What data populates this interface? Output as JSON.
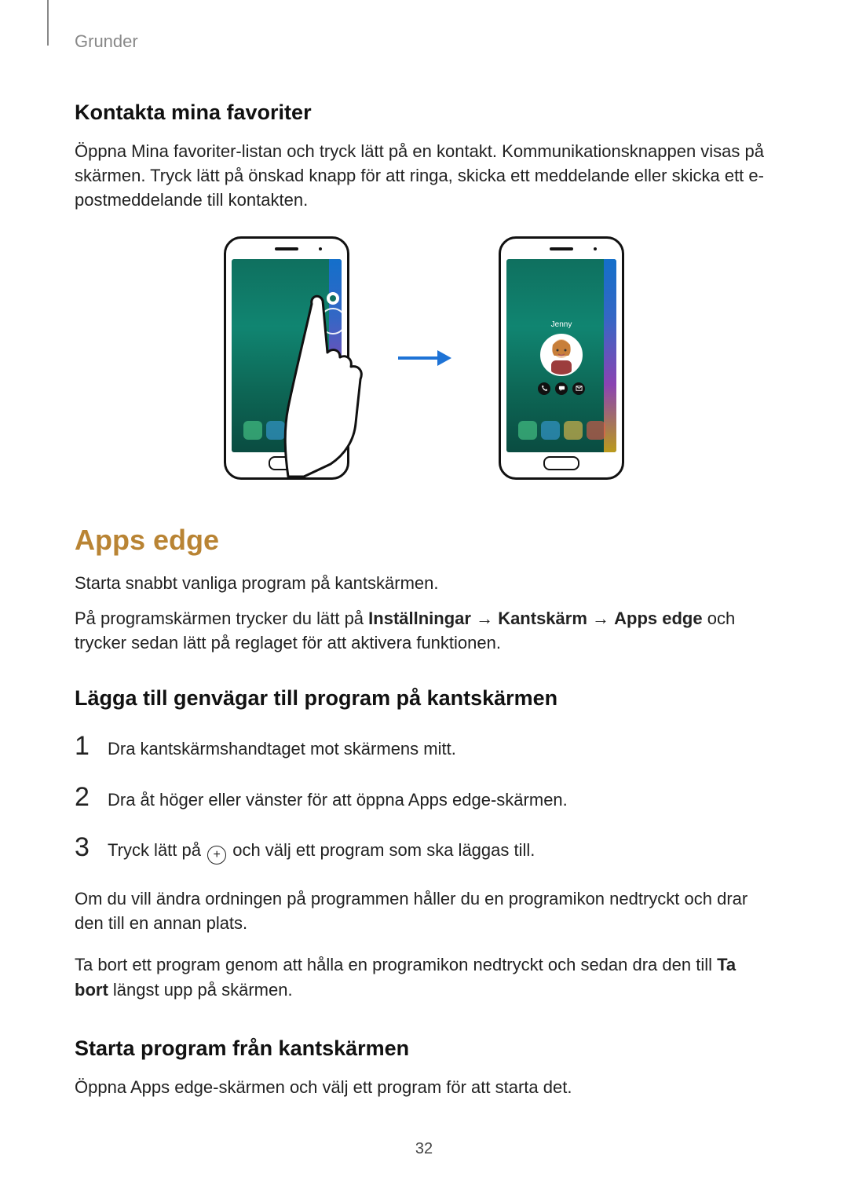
{
  "header": {
    "category": "Grunder"
  },
  "section1": {
    "heading": "Kontakta mina favoriter",
    "body": "Öppna Mina favoriter-listan och tryck lätt på en kontakt. Kommunikationsknappen visas på skärmen. Tryck lätt på önskad knapp för att ringa, skicka ett meddelande eller skicka ett e-postmeddelande till kontakten."
  },
  "illustration": {
    "contact_name": "Jenny"
  },
  "section2": {
    "title": "Apps edge",
    "intro": "Starta snabbt vanliga program på kantskärmen.",
    "path_pre": "På programskärmen trycker du lätt på ",
    "path_a": "Inställningar",
    "path_b": "Kantskärm",
    "path_c": "Apps edge",
    "path_post": " och trycker sedan lätt på reglaget för att aktivera funktionen.",
    "arrow": " → "
  },
  "section3": {
    "heading": "Lägga till genvägar till program på kantskärmen",
    "steps": [
      "Dra kantskärmshandtaget mot skärmens mitt.",
      "Dra åt höger eller vänster för att öppna Apps edge-skärmen."
    ],
    "step3_pre": "Tryck lätt på ",
    "step3_post": " och välj ett program som ska läggas till.",
    "followup": "Om du vill ändra ordningen på programmen håller du en programikon nedtryckt och drar den till en annan plats.",
    "delete_pre": "Ta bort ett program genom att hålla en programikon nedtryckt och sedan dra den till ",
    "delete_bold": "Ta bort",
    "delete_post": " längst upp på skärmen."
  },
  "section4": {
    "heading": "Starta program från kantskärmen",
    "body": "Öppna Apps edge-skärmen och välj ett program för att starta det."
  },
  "page_number": "32"
}
